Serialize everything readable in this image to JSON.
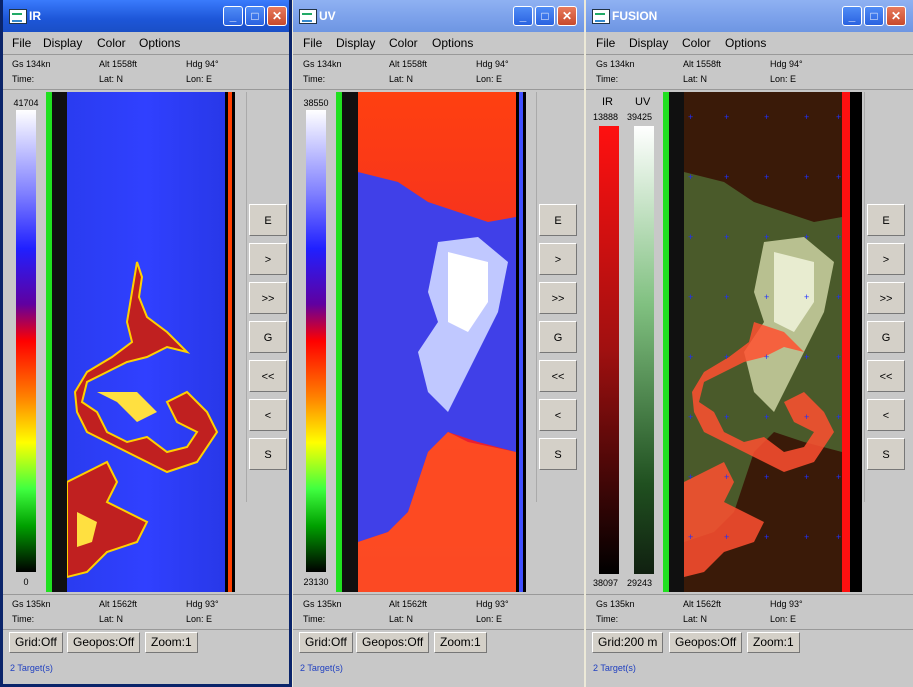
{
  "menu": [
    "File",
    "Display",
    "Color",
    "Options"
  ],
  "windows": [
    {
      "title": "IR",
      "top_info": {
        "gs": "Gs 134kn",
        "alt": "Alt 1558ft",
        "hdg": "Hdg 94°",
        "time": "Time:",
        "lat": "Lat: N",
        "lon": "Lon: E"
      },
      "bottom_info": {
        "gs": "Gs 135kn",
        "alt": "Alt 1562ft",
        "hdg": "Hdg 93°",
        "time": "Time:",
        "lat": "Lat: N",
        "lon": "Lon: E"
      },
      "scale_max": "41704",
      "scale_min": "0",
      "footer": {
        "grid": "Grid:Off",
        "geopos": "Geopos:Off",
        "zoom": "Zoom:1"
      },
      "targets": "2 Target(s)"
    },
    {
      "title": "UV",
      "top_info": {
        "gs": "Gs 134kn",
        "alt": "Alt 1558ft",
        "hdg": "Hdg 94°",
        "time": "Time:",
        "lat": "Lat: N",
        "lon": "Lon: E"
      },
      "bottom_info": {
        "gs": "Gs 135kn",
        "alt": "Alt 1562ft",
        "hdg": "Hdg 93°",
        "time": "Time:",
        "lat": "Lat: N",
        "lon": "Lon: E"
      },
      "scale_max": "38550",
      "scale_min": "23130",
      "footer": {
        "grid": "Grid:Off",
        "geopos": "Geopos:Off",
        "zoom": "Zoom:1"
      },
      "targets": "2 Target(s)"
    },
    {
      "title": "FUSION",
      "top_info": {
        "gs": "Gs 134kn",
        "alt": "Alt 1558ft",
        "hdg": "Hdg 94°",
        "time": "Time:",
        "lat": "Lat: N",
        "lon": "Lon: E"
      },
      "bottom_info": {
        "gs": "Gs 135kn",
        "alt": "Alt 1562ft",
        "hdg": "Hdg 93°",
        "time": "Time:",
        "lat": "Lat: N",
        "lon": "Lon: E"
      },
      "ir_label": "IR",
      "uv_label": "UV",
      "ir_max": "13888",
      "ir_min": "38097",
      "uv_max": "39425",
      "uv_min": "29243",
      "footer": {
        "grid": "Grid:200 m",
        "geopos": "Geopos:Off",
        "zoom": "Zoom:1"
      },
      "targets": "2 Target(s)"
    }
  ],
  "nav_buttons": [
    "E",
    ">",
    ">>",
    "G",
    "<<",
    "<",
    "S"
  ],
  "icons": {
    "window": "app-icon",
    "min": "minimize-icon",
    "max": "maximize-icon",
    "close": "close-icon"
  }
}
